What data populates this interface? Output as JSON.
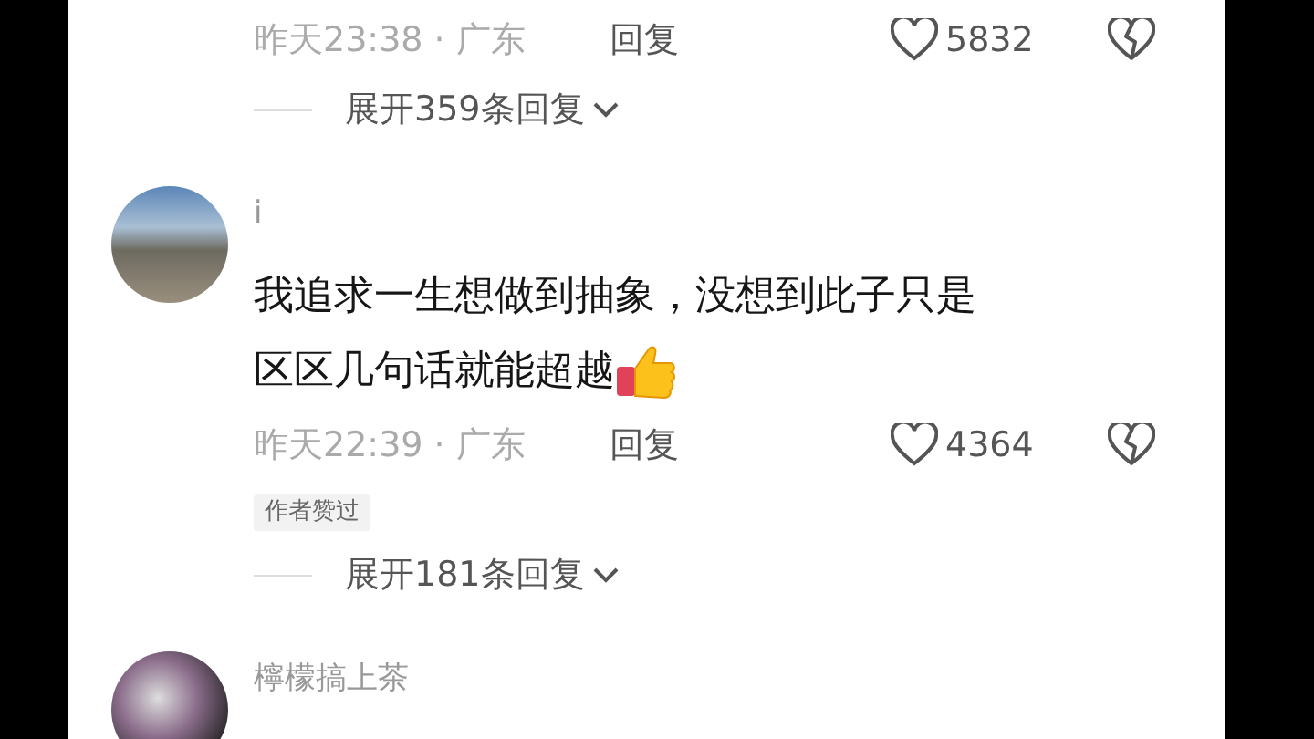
{
  "comments": [
    {
      "time_location": "昨天23:38 · 广东",
      "reply": "回复",
      "likes": "5832",
      "expand": "展开359条回复"
    },
    {
      "username": "i",
      "text_lines": [
        "我追求一生想做到抽象，没想到此子只是",
        "区区几句话就能超越"
      ],
      "time_location": "昨天22:39 · 广东",
      "reply": "回复",
      "likes": "4364",
      "author_liked": "作者赞过",
      "expand": "展开181条回复"
    },
    {
      "username": "檸檬搞上茶"
    }
  ]
}
